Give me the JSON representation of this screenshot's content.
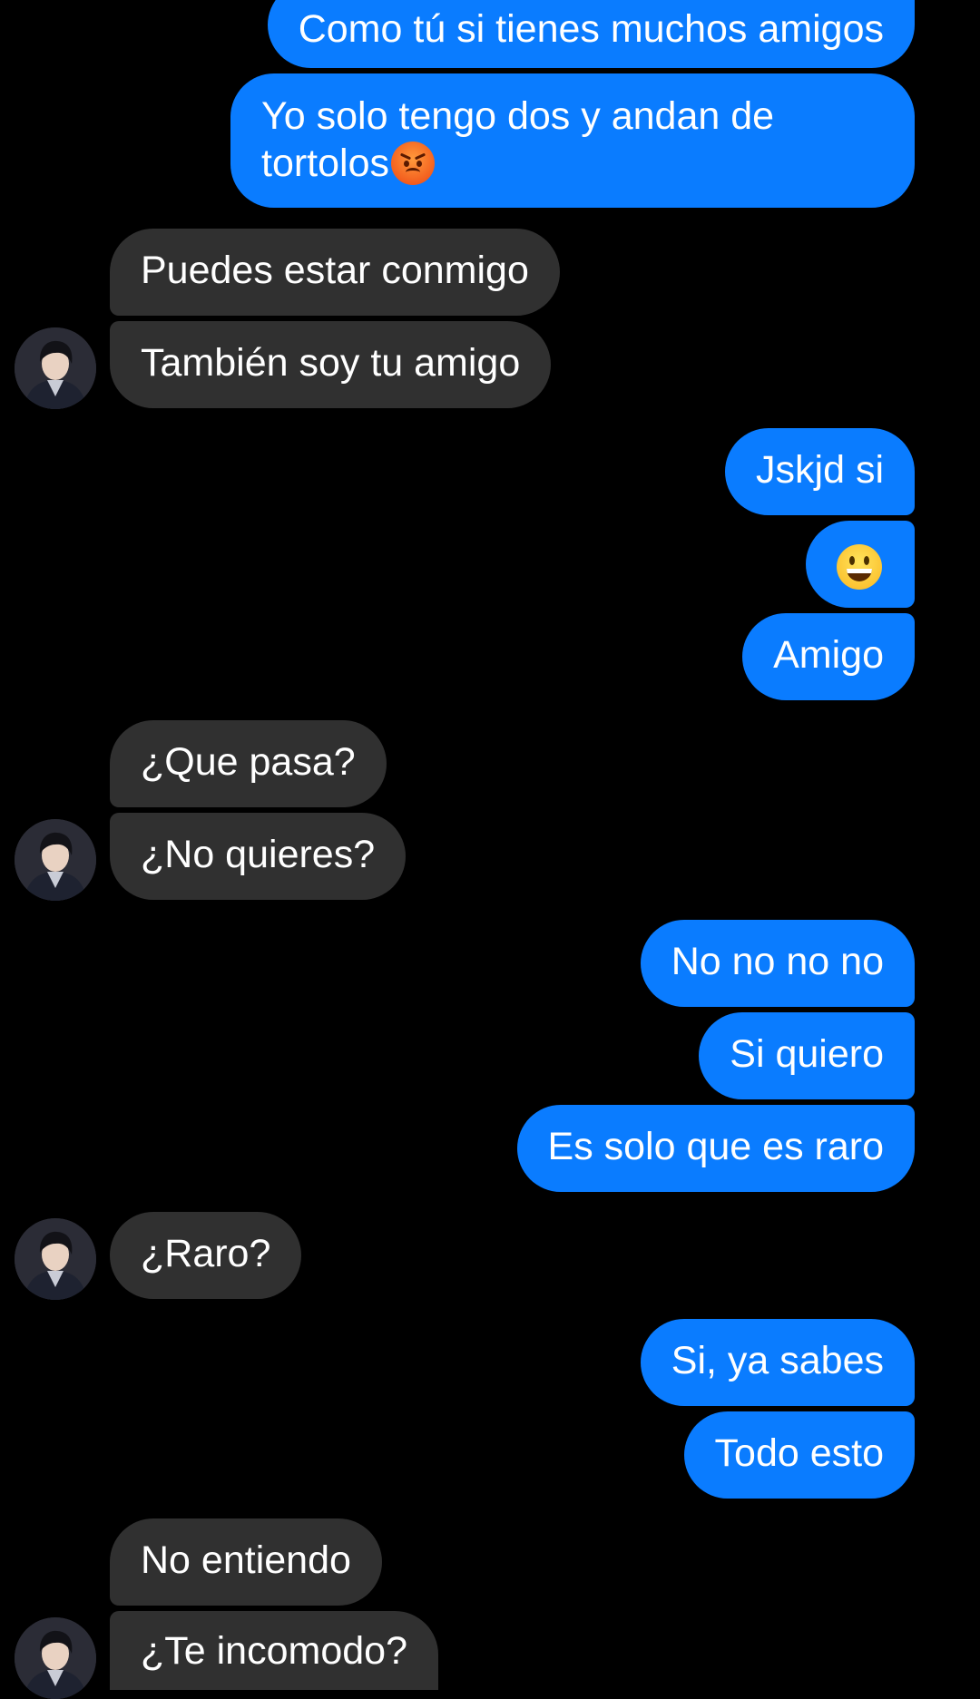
{
  "conversation": {
    "messages": [
      {
        "from": "me",
        "text": "Como tú si tienes muchos amigos"
      },
      {
        "from": "me",
        "text": "Yo solo tengo dos y andan de tortolos",
        "emoji": "angry-face-icon"
      },
      {
        "from": "them",
        "text": "Puedes estar conmigo"
      },
      {
        "from": "them",
        "text": "También soy tu amigo"
      },
      {
        "from": "me",
        "text": "Jskjd si"
      },
      {
        "from": "me",
        "emoji": "grinning-face-icon"
      },
      {
        "from": "me",
        "text": "Amigo"
      },
      {
        "from": "them",
        "text": "¿Que pasa?"
      },
      {
        "from": "them",
        "text": "¿No quieres?"
      },
      {
        "from": "me",
        "text": "No no no no"
      },
      {
        "from": "me",
        "text": "Si quiero"
      },
      {
        "from": "me",
        "text": "Es solo que es raro"
      },
      {
        "from": "them",
        "text": "¿Raro?"
      },
      {
        "from": "me",
        "text": "Si, ya sabes"
      },
      {
        "from": "me",
        "text": "Todo esto"
      },
      {
        "from": "them",
        "text": "No entiendo"
      },
      {
        "from": "them",
        "text": "¿Te incomodo?"
      }
    ]
  },
  "colors": {
    "background": "#000000",
    "outgoing_bubble": "#0a7cff",
    "incoming_bubble": "#303030",
    "text": "#ffffff"
  }
}
